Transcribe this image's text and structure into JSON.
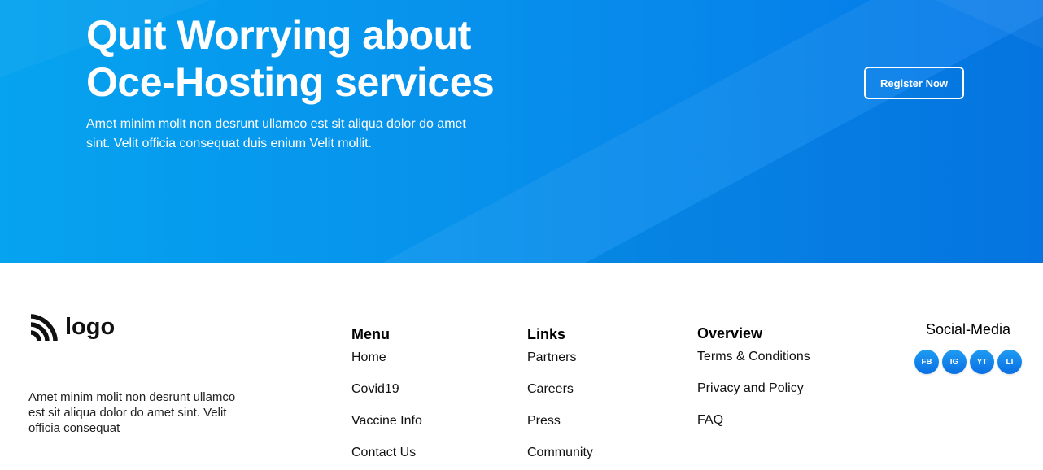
{
  "hero": {
    "title_line1": "Quit Worrying about",
    "title_line2": "Oce-Hosting services",
    "subtitle": "Amet minim molit non desrunt ullamco est sit aliqua dolor do amet sint. Velit officia consequat duis enium Velit mollit.",
    "register_label": "Register Now",
    "colors": {
      "gradient_start": "#06a3ef",
      "gradient_end": "#0678e8"
    }
  },
  "footer": {
    "logo_text": "logo",
    "logo_icon": "rss-feed-icon",
    "description": "Amet minim molit non desrunt ullamco est sit aliqua dolor do amet sint. Velit officia consequat",
    "menu": {
      "title": "Menu",
      "items": [
        "Home",
        "Covid19",
        "Vaccine Info",
        "Contact Us"
      ]
    },
    "links": {
      "title": "Links",
      "items": [
        "Partners",
        "Careers",
        "Press",
        "Community"
      ]
    },
    "overview": {
      "title": "Overview",
      "items": [
        "Terms & Conditions",
        "Privacy and Policy",
        "FAQ"
      ]
    },
    "social": {
      "title": "Social-Media",
      "icons": [
        {
          "label": "FB",
          "icon": "facebook-icon"
        },
        {
          "label": "IG",
          "icon": "instagram-icon"
        },
        {
          "label": "YT",
          "icon": "youtube-icon"
        },
        {
          "label": "LI",
          "icon": "linkedin-icon"
        }
      ]
    }
  }
}
